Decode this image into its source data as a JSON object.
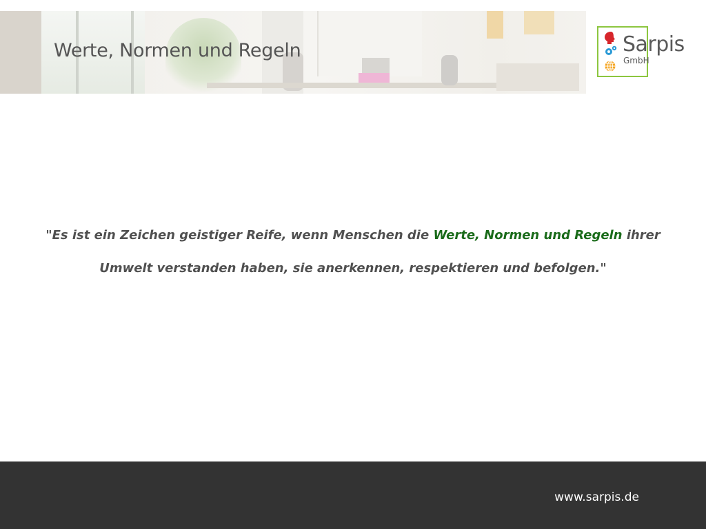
{
  "header": {
    "title": "Werte, Normen und Regeln"
  },
  "logo": {
    "name": "Sarpis",
    "suffix": "GmbH",
    "border_color": "#8cc63f"
  },
  "quote": {
    "part1": "\"Es ist ein Zeichen geistiger Reife, wenn Menschen die ",
    "highlight": "Werte, Normen und Regeln",
    "part2": " ihrer",
    "line2": "Umwelt verstanden haben, sie anerkennen, respektieren und befolgen.\"",
    "highlight_color": "#1a6b1a",
    "text_color": "#505050"
  },
  "footer": {
    "url": "www.sarpis.de",
    "background": "#333333"
  }
}
